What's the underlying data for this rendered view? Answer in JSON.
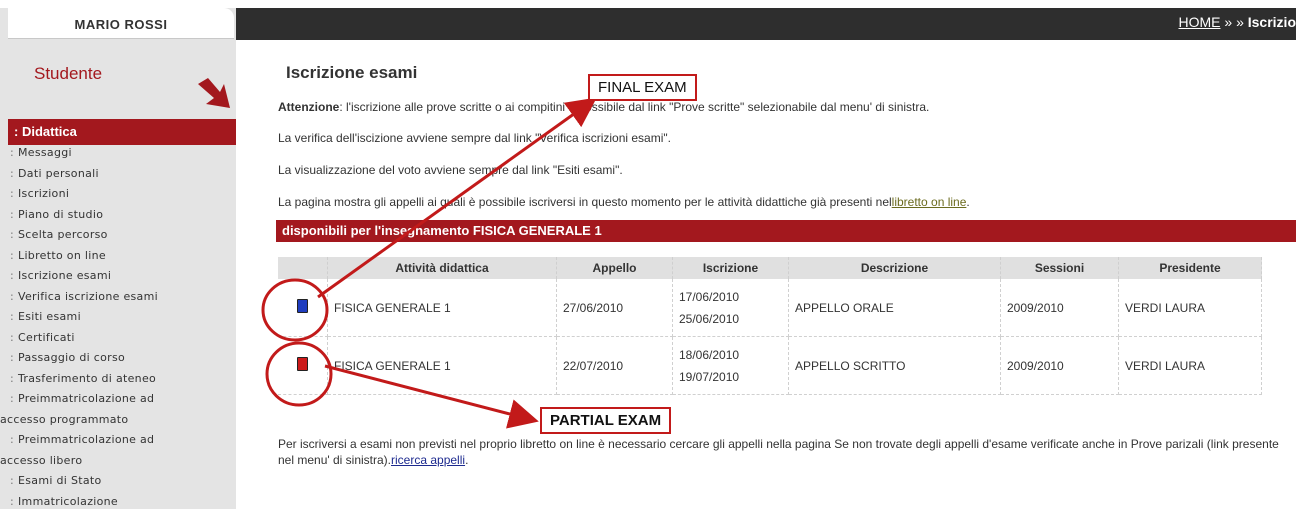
{
  "breadcrumb": {
    "home": "HOME",
    "sep": "»  »",
    "current": "Iscrizio"
  },
  "sidebar": {
    "username": "MARIO ROSSI",
    "role": "Studente",
    "section": ": Didattica",
    "items": [
      {
        "label": "Messaggi"
      },
      {
        "label": "Dati personali"
      },
      {
        "label": "Iscrizioni"
      },
      {
        "label": "Piano di studio"
      },
      {
        "label": "Scelta percorso"
      },
      {
        "label": "Libretto on line"
      },
      {
        "label": "Iscrizione esami"
      },
      {
        "label": "Verifica iscrizione esami"
      },
      {
        "label": "Esiti esami"
      },
      {
        "label": "Certificati"
      },
      {
        "label": "Passaggio di corso"
      },
      {
        "label": "Trasferimento di ateneo"
      },
      {
        "label": "Preimmatricolazione ad",
        "cont": "accesso programmato"
      },
      {
        "label": "Preimmatricolazione ad",
        "cont": "accesso libero"
      },
      {
        "label": "Esami di Stato"
      },
      {
        "label": "Immatricolazione"
      }
    ]
  },
  "main": {
    "title": "Iscrizione esami",
    "attention_label": "Attenzione",
    "attention_text": ": l'iscrizione alle prove scritte o ai compitini è possibile dal link \"Prove scritte\" selezionabile dal menu' di sinistra.",
    "line2": "La verifica dell'iscizione avviene sempre dal link \"Verifica iscrizioni esami\".",
    "line3": "La visualizzazione del voto avviene sempre dal link \"Esiti esami\".",
    "line4_text": "La pagina mostra gli appelli ai quali è possibile iscriversi in questo momento per le attività didattiche già presenti nel",
    "line4_link": "libretto on line",
    "line4_end": ".",
    "bar_title": "disponibili per l'insegnamento FISICA GENERALE 1",
    "table": {
      "headers": [
        "",
        "Attività didattica",
        "Appello",
        "Iscrizione",
        "Descrizione",
        "Sessioni",
        "Presidente"
      ],
      "rows": [
        {
          "icon": "blue-book-icon",
          "attivita": "FISICA GENERALE 1",
          "appello": "27/06/2010",
          "iscr_from": "17/06/2010",
          "iscr_to": "25/06/2010",
          "descrizione": "APPELLO ORALE",
          "sessioni": "2009/2010",
          "presidente": "VERDI LAURA"
        },
        {
          "icon": "red-book-icon",
          "attivita": "FISICA GENERALE 1",
          "appello": "22/07/2010",
          "iscr_from": "18/06/2010",
          "iscr_to": "19/07/2010",
          "descrizione": "APPELLO SCRITTO",
          "sessioni": "2009/2010",
          "presidente": "VERDI LAURA"
        }
      ]
    },
    "footer_text": "Per iscriversi a esami non previsti nel proprio libretto on line è necessario cercare gli appelli nella pagina Se non trovate degli appelli d'esame verificate anche in Prove parizali (link presente nel menu' di sinistra).",
    "footer_link": "ricerca appelli",
    "footer_end": "."
  },
  "annotations": {
    "final_exam": "FINAL EXAM",
    "partial_exam": "PARTIAL EXAM",
    "color": "#c21a1a"
  }
}
